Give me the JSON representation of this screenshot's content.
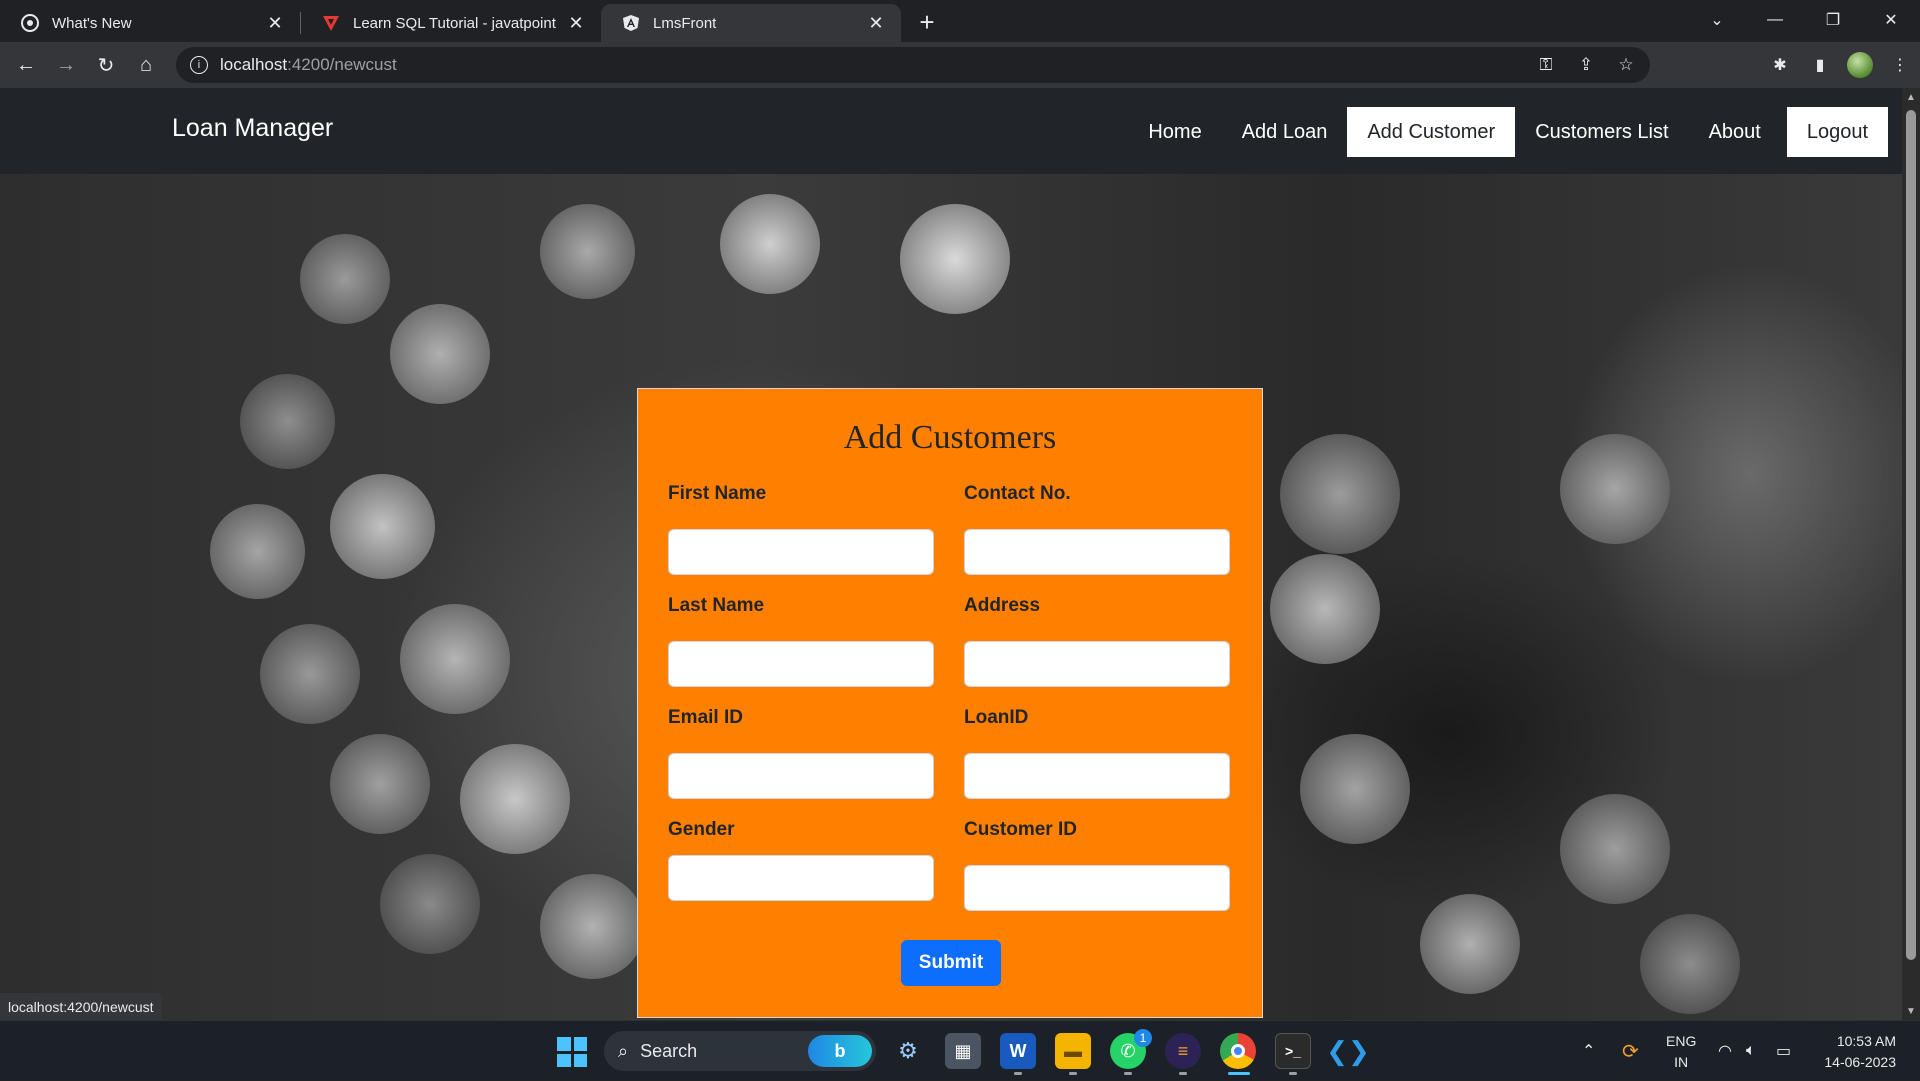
{
  "browser": {
    "tabs": [
      {
        "title": "What's New",
        "icon": "chrome-icon"
      },
      {
        "title": "Learn SQL Tutorial - javatpoint",
        "icon": "javatpoint-icon"
      },
      {
        "title": "LmsFront",
        "icon": "angular-icon"
      }
    ],
    "url_host": "localhost",
    "url_path": ":4200/newcust",
    "status_url": "localhost:4200/newcust"
  },
  "navbar": {
    "brand": "Loan Manager",
    "links": [
      "Home",
      "Add Loan",
      "Add Customer",
      "Customers List",
      "About",
      "Logout"
    ]
  },
  "form": {
    "title": "Add Customers",
    "labels": {
      "first_name": "First Name",
      "contact_no": "Contact No.",
      "last_name": "Last Name",
      "address": "Address",
      "email_id": "Email ID",
      "loan_id": "LoanID",
      "gender": "Gender",
      "customer_id": "Customer ID"
    },
    "values": {
      "first_name": "",
      "contact_no": "",
      "last_name": "",
      "address": "",
      "email_id": "",
      "loan_id": "",
      "gender": "",
      "customer_id": ""
    },
    "submit_label": "Submit",
    "card_color": "#ff8000",
    "button_color": "#0d6efd"
  },
  "taskbar": {
    "search_placeholder": "Search",
    "whatsapp_badge": "1",
    "language": "ENG",
    "region": "IN",
    "time": "10:53 AM",
    "date": "14-06-2023"
  }
}
